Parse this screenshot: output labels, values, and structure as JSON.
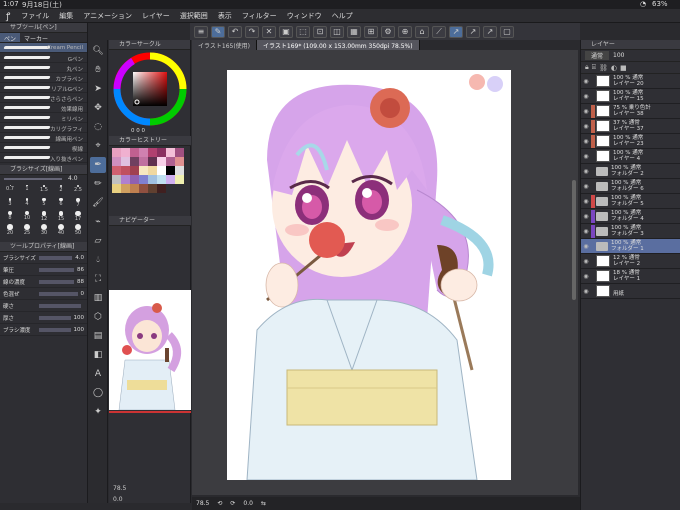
{
  "status": {
    "time": "1:07",
    "date": "9月18日(土)",
    "battery": "63%"
  },
  "menu": [
    "ファイル",
    "編集",
    "アニメーション",
    "レイヤー",
    "選択範囲",
    "表示",
    "フィルター",
    "ウィンドウ",
    "ヘルプ"
  ],
  "subtool": {
    "title": "サブツール[ペン]",
    "tabs": [
      "ペン",
      "マーカー"
    ],
    "brushes": [
      "Cream Pencil",
      "Gペン",
      "丸ペン",
      "カブラペン",
      "リアルGペン",
      "さらさらペン",
      "効果線用",
      "ミリペン",
      "カリグラフィ",
      "線画用ペン",
      "楔線",
      "入り抜きペン"
    ],
    "size_label": "ブラシサイズ[線画]",
    "size_value": "4.0",
    "size_presets": [
      "0.7",
      "1",
      "1.5",
      "2",
      "2.5",
      "3",
      "4",
      "5",
      "6",
      "7",
      "8",
      "10",
      "12",
      "15",
      "17",
      "20",
      "25",
      "30",
      "40",
      "50"
    ],
    "props_title": "ツールプロパティ[線画]",
    "props": [
      {
        "label": "ブラシサイズ",
        "value": "4.0"
      },
      {
        "label": "筆圧",
        "value": "86"
      },
      {
        "label": "線の濃度",
        "value": "88"
      },
      {
        "label": "色混ぜ",
        "value": "0"
      },
      {
        "label": "硬さ",
        "value": ""
      },
      {
        "label": "厚さ",
        "value": "100"
      },
      {
        "label": "ブラシ濃度",
        "value": "100"
      }
    ]
  },
  "color": {
    "wheel_title": "カラーサークル",
    "values": "0 0 0",
    "history_title": "カラーヒストリー",
    "navigator_title": "ナビゲーター",
    "swatches": [
      "#e8a0c0",
      "#f0b0d0",
      "#c06090",
      "#d080b0",
      "#b04070",
      "#8a3060",
      "#f4c0d8",
      "#a05080",
      "#d090c0",
      "#e0c0e0",
      "#704060",
      "#c070a0",
      "#603050",
      "#f8d0e8",
      "#b06090",
      "#e09090",
      "#d06070",
      "#c05060",
      "#a04050",
      "#f8e8c0",
      "#f0d8a0",
      "#ffffff",
      "#000000",
      "#e0e0e0",
      "#c0c0c0",
      "#b080d0",
      "#9060b0",
      "#8080d0",
      "#a0c0e0",
      "#c0e0f0",
      "#d0b0f0",
      "#f0f0b0",
      "#e8d080",
      "#d0a060",
      "#c08050",
      "#905040",
      "#604030",
      "#402020"
    ]
  },
  "tabs": [
    "イラスト165(使用)",
    "イラスト169* (109.00 x 153.00mm 350dpi 78.5%)"
  ],
  "canvas": {
    "zoom": "78.5",
    "angle": "0.0"
  },
  "layers": {
    "title": "レイヤー",
    "blend": "通常",
    "opacity": "100",
    "items": [
      {
        "name": "レイヤー 20",
        "info": "100 % 通常",
        "type": "layer"
      },
      {
        "name": "レイヤー 15",
        "info": "100 % 通常",
        "type": "layer"
      },
      {
        "name": "レイヤー 38",
        "info": "75 % 乗り色計",
        "type": "layer",
        "tag": "#c0604a"
      },
      {
        "name": "レイヤー 37",
        "info": "37 % 通常",
        "type": "layer",
        "tag": "#c0604a"
      },
      {
        "name": "レイヤー 23",
        "info": "100 % 通常",
        "type": "layer",
        "tag": "#c0604a"
      },
      {
        "name": "レイヤー 4",
        "info": "100 % 通常",
        "type": "layer"
      },
      {
        "name": "フォルダー 2",
        "info": "100 % 通常",
        "type": "folder"
      },
      {
        "name": "フォルダー 6",
        "info": "100 % 通常",
        "type": "folder"
      },
      {
        "name": "フォルダー 5",
        "info": "100 % 通常",
        "type": "folder",
        "tag": "#d04848"
      },
      {
        "name": "フォルダー 4",
        "info": "100 % 通常",
        "type": "folder",
        "tag": "#7a46c0"
      },
      {
        "name": "フォルダー 3",
        "info": "100 % 通常",
        "type": "folder",
        "tag": "#7a46c0"
      },
      {
        "name": "フォルダー 1",
        "info": "100 % 通常",
        "type": "folder",
        "selected": true
      },
      {
        "name": "レイヤー 2",
        "info": "12 % 通常",
        "type": "layer"
      },
      {
        "name": "レイヤー 1",
        "info": "18 % 通常",
        "type": "layer"
      },
      {
        "name": "用紙",
        "info": "",
        "type": "paper"
      }
    ]
  }
}
